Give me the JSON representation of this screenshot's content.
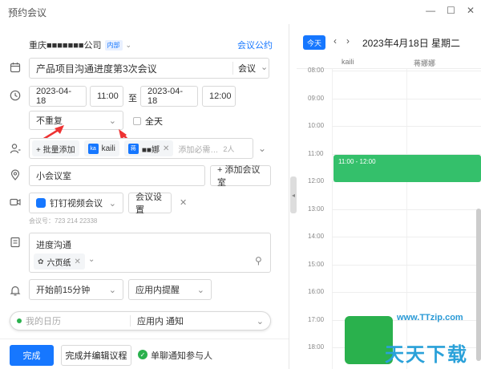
{
  "window": {
    "title": "预约会议",
    "min": "—",
    "max": "☐",
    "close": "✕"
  },
  "org": {
    "name": "重庆■■■■■■■公司",
    "badge": "内部",
    "link": "会议公约"
  },
  "topic": {
    "value": "产品项目沟通进度第3次会议",
    "type": "会议"
  },
  "time": {
    "start_date": "2023-04-18",
    "start_time": "11:00",
    "to": "至",
    "end_date": "2023-04-18",
    "end_time": "12:00"
  },
  "repeat": {
    "value": "不重复",
    "all_day": "全天"
  },
  "attendees": {
    "add": "+ 批量添加",
    "people": [
      {
        "avatar": "ka",
        "name": "kaili"
      },
      {
        "avatar": "蒋",
        "name": "■■娜"
      }
    ],
    "placeholder": "添加必需…",
    "count": "2人"
  },
  "location": {
    "value": "小会议室",
    "add_room": "+ 添加会议室"
  },
  "video": {
    "app": "钉钉视频会议",
    "settings": "会议设置",
    "meeting_id": "会议号：723 214 22338"
  },
  "description": {
    "value": "进度沟通",
    "doc": "六页纸"
  },
  "reminder": {
    "value": "开始前15分钟",
    "channel": "应用内提醒"
  },
  "calendar_select": {
    "value": "我的日历",
    "notify": "应用内 通知"
  },
  "footer": {
    "done": "完成",
    "done_edit": "完成并编辑议程",
    "notify_single": "单聊通知参与人"
  },
  "calendar": {
    "today": "今天",
    "prev": "‹",
    "next": "›",
    "date": "2023年4月18日 星期二",
    "columns": [
      "kaili",
      "蒋娜娜"
    ],
    "hours": [
      "08:00",
      "09:00",
      "10:00",
      "11:00",
      "12:00",
      "13:00",
      "14:00",
      "15:00",
      "16:00",
      "17:00",
      "18:00"
    ],
    "event": "11:00 - 12:00"
  },
  "watermark": {
    "site": "www.TTzip.com",
    "brand": "天天下载"
  }
}
